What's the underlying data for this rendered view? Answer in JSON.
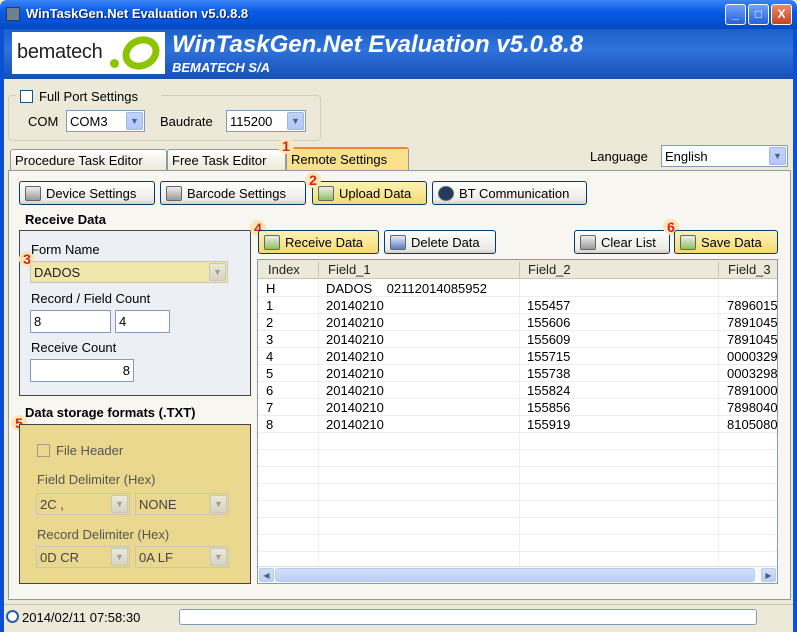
{
  "window": {
    "title": "WinTaskGen.Net Evaluation v5.0.8.8",
    "controls": [
      "_",
      "□",
      "X"
    ]
  },
  "banner": {
    "logo_text": "bematech",
    "title": "WinTaskGen.Net Evaluation v5.0.8.8",
    "subtitle": "BEMATECH S/A"
  },
  "port": {
    "full_port_label": "Full Port Settings",
    "full_port_checked": false,
    "com_label": "COM",
    "com_value": "COM3",
    "baudrate_label": "Baudrate",
    "baudrate_value": "115200"
  },
  "tabs": [
    {
      "label": "Procedure Task Editor",
      "active": false
    },
    {
      "label": "Free Task Editor",
      "active": false
    },
    {
      "label": "Remote Settings",
      "active": true
    }
  ],
  "language": {
    "label": "Language",
    "value": "English"
  },
  "toolbar": {
    "device_settings": "Device Settings",
    "barcode_settings": "Barcode Settings",
    "upload_data": "Upload Data",
    "bt_communication": "BT Communication"
  },
  "receive": {
    "section_title": "Receive Data",
    "form_name_label": "Form Name",
    "form_name_value": "DADOS",
    "record_field_label": "Record / Field Count",
    "record_count": "8",
    "field_count": "4",
    "receive_count_label": "Receive Count",
    "receive_count": "8"
  },
  "storage": {
    "section_title": "Data storage formats (.TXT)",
    "file_header_label": "File Header",
    "field_delim_label": "Field Delimiter (Hex)",
    "field_delim_1": "2C ,",
    "field_delim_2": "NONE",
    "record_delim_label": "Record Delimiter (Hex)",
    "record_delim_1": "0D CR",
    "record_delim_2": "0A LF"
  },
  "actions": {
    "receive_data": "Receive Data",
    "delete_data": "Delete Data",
    "clear_list": "Clear List",
    "save_data": "Save Data"
  },
  "badges": [
    "1",
    "2",
    "3",
    "4",
    "5",
    "6"
  ],
  "table": {
    "columns": [
      "Index",
      "Field_1",
      "Field_2",
      "Field_3"
    ],
    "rows": [
      [
        "H",
        "DADOS    02112014085952",
        "",
        ""
      ],
      [
        "1",
        "20140210",
        "155457",
        "7896015"
      ],
      [
        "2",
        "20140210",
        "155606",
        "7891045"
      ],
      [
        "3",
        "20140210",
        "155609",
        "7891045"
      ],
      [
        "4",
        "20140210",
        "155715",
        "0000329"
      ],
      [
        "5",
        "20140210",
        "155738",
        "0003298"
      ],
      [
        "6",
        "20140210",
        "155824",
        "7891000"
      ],
      [
        "7",
        "20140210",
        "155856",
        "7898040"
      ],
      [
        "8",
        "20140210",
        "155919",
        "8105080"
      ]
    ]
  },
  "status": {
    "datetime": "2014/02/11 07:58:30"
  },
  "icons": {
    "app": "app-icon",
    "clock": "clock-icon",
    "device": "device-settings-icon",
    "barcode": "barcode-icon",
    "upload": "upload-icon",
    "bluetooth": "bluetooth-icon",
    "receive": "receive-icon",
    "delete": "delete-icon",
    "clear": "clear-list-icon",
    "save": "save-icon"
  }
}
